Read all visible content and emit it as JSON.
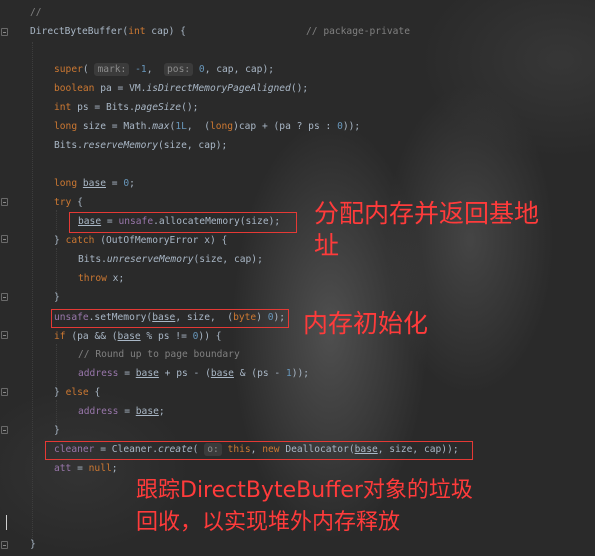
{
  "editor": {
    "colors": {
      "background": "#2b2b2b",
      "keyword": "#cc7832",
      "field": "#9876aa",
      "number": "#6897bb",
      "comment": "#808080",
      "text": "#a9b7c6",
      "annotation": "#ff3b3b"
    },
    "code": {
      "l1": "//",
      "l2_sig": "DirectByteBuffer(",
      "l2_kw_int": "int",
      "l2_rest": " cap) {",
      "l2_comment": "// package-private",
      "super_kw": "super",
      "super_open": "( ",
      "hint_mark": "mark:",
      "minus_one": "-1",
      "comma": ",  ",
      "hint_pos": "pos:",
      "zero": "0",
      "super_tail": ", cap, cap);",
      "bool_kw": "boolean",
      "bool_mid": " pa = VM.",
      "bool_method": "isDirectMemoryPageAligned",
      "bool_tail": "();",
      "int_kw": "int",
      "ps_mid": " ps = Bits.",
      "ps_method": "pageSize",
      "ps_tail": "();",
      "long_kw": "long",
      "size_mid": " size = Math.",
      "size_method": "max",
      "size_open": "(",
      "size_1l": "1L",
      "size_sep": ",  (",
      "size_cast": "long",
      "size_tail_a": ")cap + (pa ? ps : ",
      "size_zero": "0",
      "size_tail_b": "));",
      "reserve_obj": "Bits.",
      "reserve_method": "reserveMemory",
      "reserve_tail": "(size, cap);",
      "base_kw": "long",
      "base_sp": " ",
      "base_var": "base",
      "base_eq": " = ",
      "base_zero": "0",
      "base_semi": ";",
      "try_kw": "try",
      "brace_open": " {",
      "alloc_base": "base",
      "alloc_eq": " = ",
      "alloc_unsafe": "unsafe",
      "alloc_call": ".allocateMemory(size);",
      "catch_close": "} ",
      "catch_kw": "catch",
      "catch_rest": " (OutOfMemoryError x) {",
      "unres_obj": "Bits.",
      "unres_method": "unreserveMemory",
      "unres_tail": "(size, cap);",
      "throw_kw": "throw",
      "throw_rest": " x;",
      "close_brace": "}",
      "set_unsafe": "unsafe",
      "set_call": ".setMemory(",
      "set_base": "base",
      "set_mid": ", size,  (",
      "set_byte": "byte",
      "set_close": ") ",
      "set_zero": "0",
      "set_tail": ");",
      "if_kw": "if",
      "if_a": " (pa && (",
      "if_base": "base",
      "if_b": " % ps != ",
      "if_zero": "0",
      "if_c": ")) {",
      "round_comment": "// Round up to page boundary",
      "addr1_field": "address",
      "addr1_eq": " = ",
      "addr1_base": "base",
      "addr1_b": " + ps - (",
      "addr1_base2": "base",
      "addr1_c": " & (ps - ",
      "addr1_one": "1",
      "addr1_d": "));",
      "else_a": "} ",
      "else_kw": "else",
      "else_b": " {",
      "addr2_field": "address",
      "addr2_eq": " = ",
      "addr2_base": "base",
      "addr2_semi": ";",
      "cleaner_field": "cleaner",
      "cleaner_eq": " = Cleaner.",
      "cleaner_method": "create",
      "cleaner_open": "( ",
      "hint_o": "o:",
      "this_kw": "this",
      "cleaner_comma": ", ",
      "new_kw": "new",
      "cleaner_dealloc": " Deallocator(",
      "cleaner_base": "base",
      "cleaner_tail": ", size, cap));",
      "att_field": "att",
      "att_eq": " = ",
      "null_kw": "null",
      "att_semi": ";",
      "final_brace": "}"
    }
  },
  "annotations": {
    "alloc_note": "分配内存并返回基地\n址",
    "init_note": "内存初始化",
    "cleaner_note": "跟踪DirectByteBuffer对象的垃圾\n回收，以实现堆外内存释放"
  }
}
